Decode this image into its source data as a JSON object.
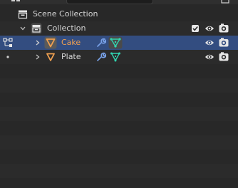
{
  "outliner": {
    "scene_collection": {
      "label": "Scene Collection"
    },
    "collection": {
      "label": "Collection"
    },
    "objects": [
      {
        "label": "Cake",
        "selected": true
      },
      {
        "label": "Plate",
        "selected": false
      }
    ]
  },
  "colors": {
    "background": "#282828",
    "selected_row": "#334d80",
    "active_text": "#f0a050",
    "object_icon": "#f0a050",
    "modifier_icon": "#78a0e6",
    "mesh_data_icon": "#31d6b0",
    "icon_default": "#e6e6e6"
  },
  "icons": {
    "scene_collection": "collection-box-icon",
    "collection": "collection-box-icon",
    "object": "mesh-object-icon",
    "modifier": "wrench-icon",
    "mesh_data": "mesh-data-icon",
    "visibility": "eye-icon",
    "render": "camera-icon",
    "expand": "chevron-right-icon",
    "collapse": "chevron-down-icon"
  }
}
